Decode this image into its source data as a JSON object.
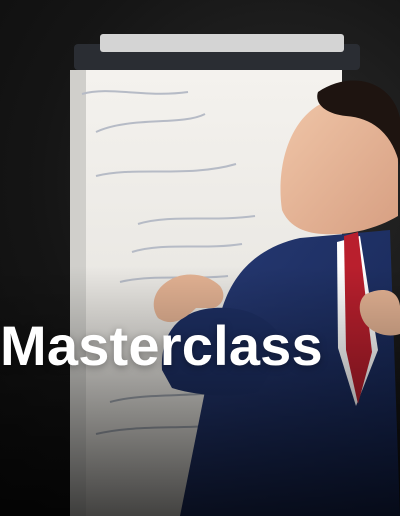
{
  "card": {
    "title": "Masterclass"
  }
}
